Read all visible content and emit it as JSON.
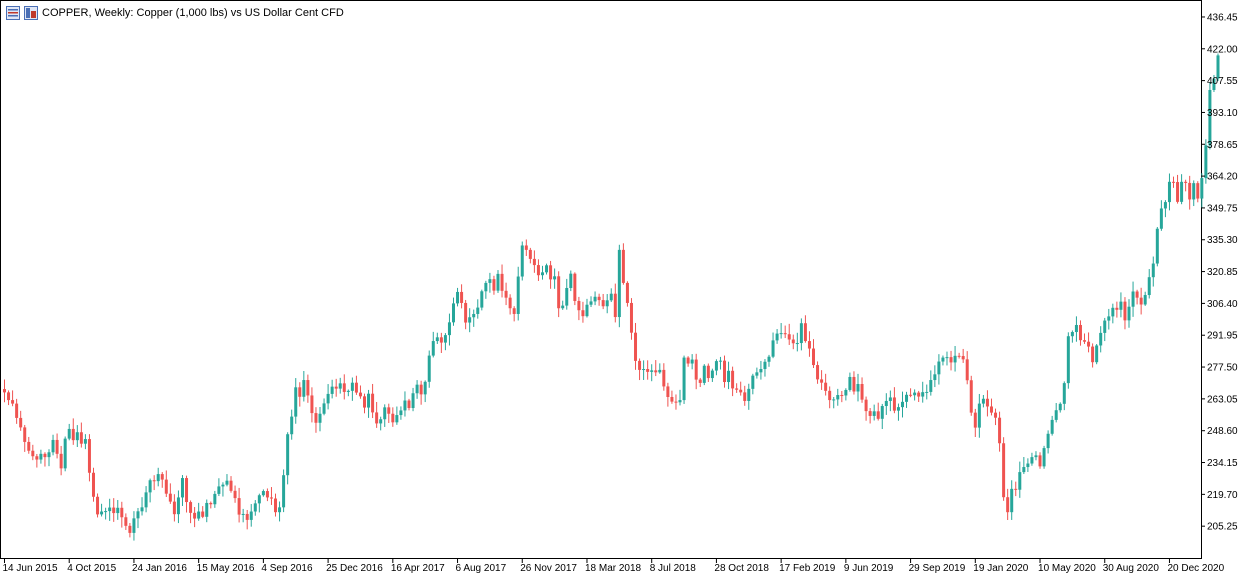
{
  "header": {
    "title": "COPPER, Weekly:  Copper (1,000 lbs) vs US Dollar Cent CFD",
    "icons": [
      "indicator-list-icon",
      "template-icon"
    ]
  },
  "colors": {
    "bull": "#26a69a",
    "bear": "#ef5350",
    "axis": "#000000",
    "background": "#ffffff"
  },
  "chart_data": {
    "type": "candlestick",
    "title": "COPPER, Weekly:  Copper (1,000 lbs) vs US Dollar Cent CFD",
    "ylim": [
      190.8,
      443.7
    ],
    "y_ticks": [
      205.25,
      219.7,
      234.15,
      248.6,
      263.05,
      277.5,
      291.95,
      306.4,
      320.85,
      335.3,
      349.75,
      364.2,
      378.65,
      393.1,
      407.55,
      422.0,
      436.45
    ],
    "y_tick_labels": [
      "205.25",
      "219.70",
      "234.15",
      "248.60",
      "263.05",
      "277.50",
      "291.95",
      "306.40",
      "320.85",
      "335.30",
      "349.75",
      "364.20",
      "378.65",
      "393.10",
      "407.55",
      "422.00",
      "436.45"
    ],
    "x_ticks": [
      {
        "label": "14 Jun 2015",
        "index": 0
      },
      {
        "label": "4 Oct 2015",
        "index": 16
      },
      {
        "label": "24 Jan 2016",
        "index": 32
      },
      {
        "label": "15 May 2016",
        "index": 48
      },
      {
        "label": "4 Sep 2016",
        "index": 64
      },
      {
        "label": "25 Dec 2016",
        "index": 80
      },
      {
        "label": "16 Apr 2017",
        "index": 96
      },
      {
        "label": "6 Aug 2017",
        "index": 112
      },
      {
        "label": "26 Nov 2017",
        "index": 128
      },
      {
        "label": "18 Mar 2018",
        "index": 144
      },
      {
        "label": "8 Jul 2018",
        "index": 160
      },
      {
        "label": "28 Oct 2018",
        "index": 176
      },
      {
        "label": "17 Feb 2019",
        "index": 192
      },
      {
        "label": "9 Jun 2019",
        "index": 208
      },
      {
        "label": "29 Sep 2019",
        "index": 224
      },
      {
        "label": "19 Jan 2020",
        "index": 240
      },
      {
        "label": "10 May 2020",
        "index": 256
      },
      {
        "label": "30 Aug 2020",
        "index": 272
      },
      {
        "label": "20 Dec 2020",
        "index": 288
      }
    ],
    "closes": [
      266.0,
      262.5,
      260.9,
      254.4,
      250.1,
      243.5,
      239.5,
      237.0,
      235.5,
      238.1,
      236.6,
      238.8,
      244.4,
      238.1,
      231.5,
      245.0,
      249.4,
      244.3,
      247.9,
      242.7,
      244.8,
      229.5,
      218.6,
      210.6,
      211.9,
      212.1,
      213.7,
      211.2,
      213.6,
      209.3,
      205.4,
      202.2,
      208.8,
      212.0,
      213.8,
      220.6,
      226.1,
      225.7,
      228.9,
      226.4,
      220.0,
      216.4,
      210.7,
      218.3,
      227.1,
      216.2,
      211.3,
      208.7,
      211.9,
      209.5,
      215.8,
      215.2,
      219.9,
      223.3,
      224.1,
      225.9,
      221.3,
      218.0,
      210.5,
      210.8,
      208.1,
      211.9,
      215.6,
      219.3,
      221.2,
      218.3,
      217.8,
      211.6,
      213.8,
      228.4,
      247.0,
      255.0,
      268.3,
      264.0,
      271.6,
      264.6,
      256.6,
      252.2,
      256.3,
      261.0,
      265.3,
      268.6,
      267.7,
      270.1,
      266.2,
      266.7,
      270.4,
      265.9,
      264.2,
      259.1,
      265.4,
      256.9,
      251.9,
      253.8,
      259.2,
      256.3,
      252.4,
      255.7,
      257.8,
      262.3,
      258.9,
      265.6,
      269.5,
      265.1,
      270.8,
      282.7,
      289.3,
      291.0,
      288.6,
      292.0,
      297.8,
      306.4,
      311.6,
      306.6,
      297.7,
      300.1,
      301.6,
      304.5,
      311.9,
      315.7,
      317.4,
      312.2,
      319.8,
      312.1,
      309.0,
      304.2,
      301.6,
      318.6,
      332.7,
      330.7,
      326.6,
      323.8,
      319.2,
      320.5,
      323.7,
      317.3,
      318.7,
      304.2,
      305.4,
      313.4,
      319.9,
      307.5,
      303.3,
      300.6,
      305.8,
      307.3,
      309.4,
      307.9,
      305.1,
      307.8,
      310.8,
      300.2,
      330.7,
      315.7,
      306.6,
      293.1,
      280.3,
      276.2,
      276.6,
      275.3,
      276.0,
      275.1,
      276.2,
      268.7,
      263.9,
      261.8,
      261.5,
      262.5,
      281.8,
      279.1,
      280.9,
      271.8,
      270.3,
      278.1,
      272.5,
      275.9,
      280.2,
      280.4,
      270.7,
      275.8,
      267.8,
      267.2,
      266.0,
      262.1,
      267.6,
      273.6,
      275.1,
      276.6,
      279.9,
      282.2,
      289.6,
      292.7,
      292.9,
      292.4,
      290.0,
      288.3,
      288.4,
      297.4,
      289.3,
      285.9,
      278.4,
      271.9,
      270.4,
      266.7,
      262.5,
      262.8,
      264.8,
      264.6,
      267.1,
      273.0,
      266.4,
      269.8,
      262.7,
      257.5,
      255.3,
      257.4,
      254.0,
      259.8,
      262.1,
      263.7,
      257.7,
      259.3,
      261.7,
      264.9,
      264.7,
      265.9,
      264.1,
      266.1,
      266.2,
      271.6,
      274.2,
      280.0,
      281.8,
      282.0,
      279.6,
      282.6,
      282.5,
      281.0,
      271.5,
      256.8,
      250.0,
      260.9,
      263.1,
      259.6,
      256.8,
      254.5,
      242.9,
      218.4,
      211.6,
      222.2,
      221.8,
      229.8,
      232.1,
      233.7,
      236.6,
      237.4,
      232.4,
      240.7,
      247.2,
      253.5,
      257.9,
      260.8,
      270.2,
      291.5,
      293.4,
      296.6,
      289.7,
      289.0,
      286.8,
      279.7,
      287.3,
      293.0,
      298.6,
      300.5,
      304.4,
      303.5,
      307.2,
      298.7,
      304.9,
      311.8,
      309.0,
      305.9,
      310.2,
      318.3,
      324.5,
      340.3,
      349.5,
      352.4,
      361.6,
      361.5,
      352.5,
      361.6,
      361.1,
      353.6,
      361.0,
      354.0,
      363.3,
      378.2,
      403.3,
      408.5,
      419.0
    ]
  }
}
